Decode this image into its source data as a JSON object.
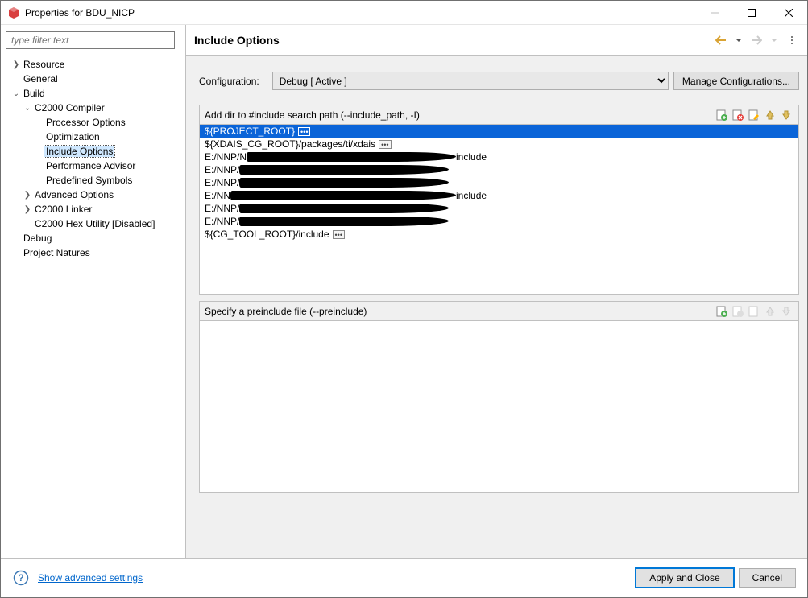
{
  "window": {
    "title": "Properties for BDU_NICP"
  },
  "filter": {
    "placeholder": "type filter text"
  },
  "tree": {
    "resource": "Resource",
    "general": "General",
    "build": "Build",
    "c2000compiler": "C2000 Compiler",
    "processor_options": "Processor Options",
    "optimization": "Optimization",
    "include_options": "Include Options",
    "performance_advisor": "Performance Advisor",
    "predefined_symbols": "Predefined Symbols",
    "advanced_options": "Advanced Options",
    "c2000linker": "C2000 Linker",
    "hex_utility": "C2000 Hex Utility  [Disabled]",
    "debug": "Debug",
    "project_natures": "Project Natures"
  },
  "header": {
    "title": "Include Options"
  },
  "config": {
    "label": "Configuration:",
    "selected": "Debug  [ Active ]",
    "manage": "Manage Configurations..."
  },
  "panel1": {
    "title": "Add dir to #include search path (--include_path, -I)",
    "items": [
      {
        "text": "${PROJECT_ROOT}",
        "ell": true,
        "selected": true
      },
      {
        "text": "${XDAIS_CG_ROOT}/packages/ti/xdais",
        "ell": true
      },
      {
        "text": "E:/NNP/N",
        "redact": 260,
        "trail": "include"
      },
      {
        "text": "E:/NNP/",
        "redact": 260,
        "trail": ""
      },
      {
        "text": "E:/NNP/",
        "redact": 260,
        "trail": ""
      },
      {
        "text": "E:/NN",
        "redact": 280,
        "trail": "include"
      },
      {
        "text": "E:/NNP/",
        "redact": 260,
        "trail": ""
      },
      {
        "text": "E:/NNP/",
        "redact": 260,
        "trail": ""
      },
      {
        "text": "${CG_TOOL_ROOT}/include",
        "ell": true
      }
    ]
  },
  "panel2": {
    "title": "Specify a preinclude file (--preinclude)"
  },
  "bottom": {
    "advanced": "Show advanced settings",
    "apply": "Apply and Close",
    "cancel": "Cancel"
  }
}
